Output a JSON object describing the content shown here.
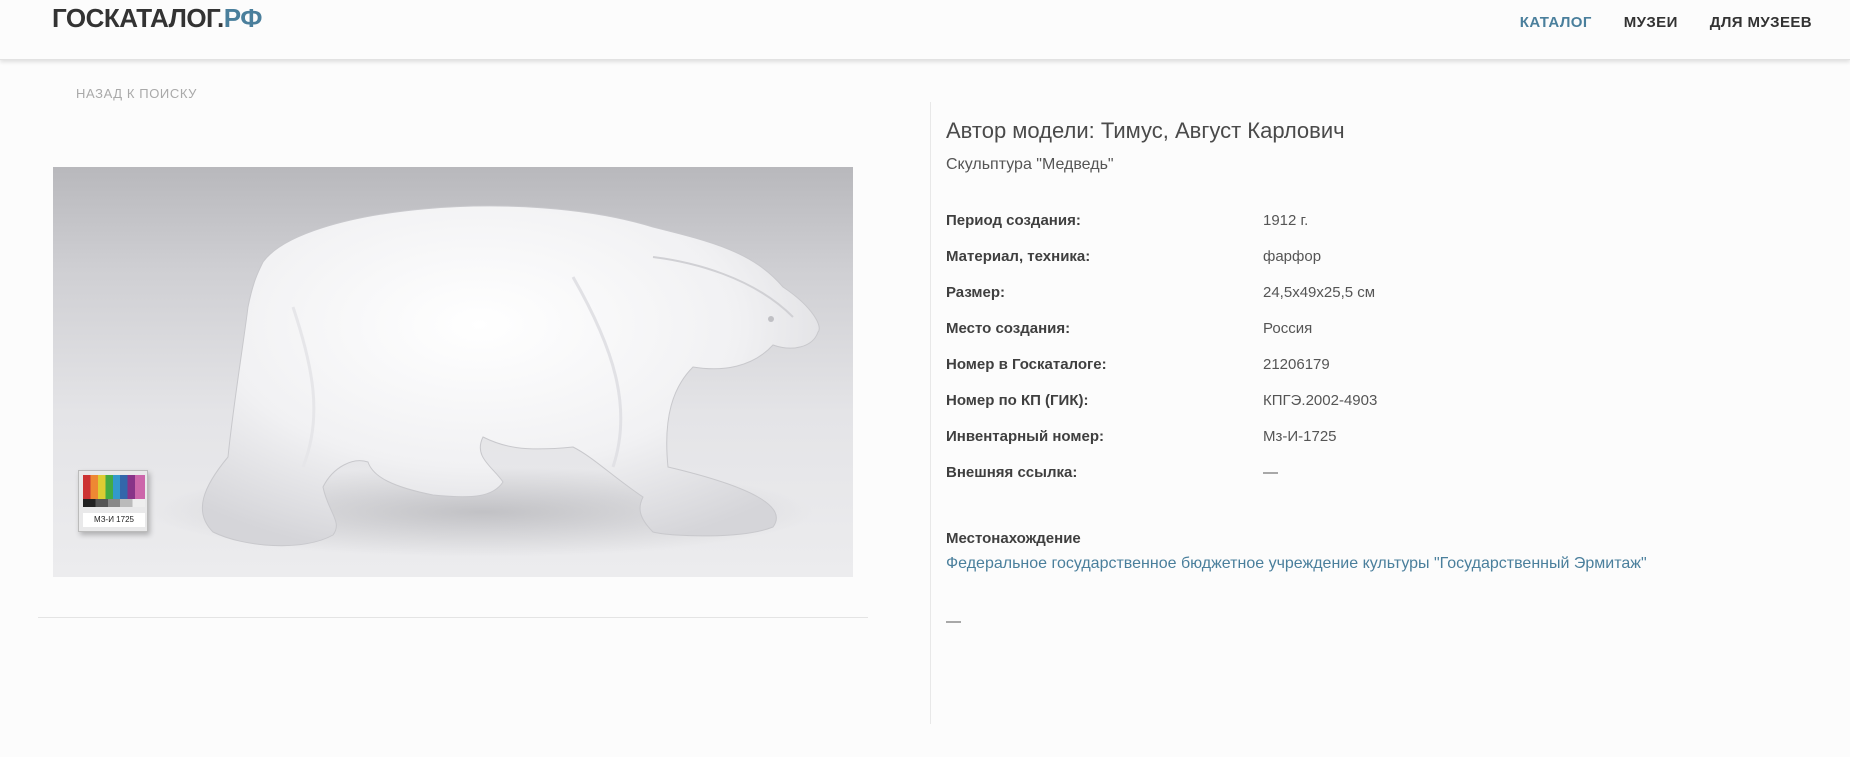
{
  "header": {
    "logo_main": "ГОСКАТАЛОГ.",
    "logo_accent": "РФ",
    "nav": [
      {
        "label": "КАТАЛОГ",
        "active": true
      },
      {
        "label": "МУЗЕИ",
        "active": false
      },
      {
        "label": "ДЛЯ МУЗЕЕВ",
        "active": false
      }
    ]
  },
  "back_link": "НАЗАД К ПОИСКУ",
  "photo": {
    "tag_text": "МЗ-И 1725"
  },
  "item": {
    "author": "Автор модели: Тимус, Август Карлович",
    "title": "Скульптура \"Медведь\"",
    "properties": [
      {
        "label": "Период создания:",
        "value": "1912 г."
      },
      {
        "label": "Материал, техника:",
        "value": "фарфор"
      },
      {
        "label": "Размер:",
        "value": "24,5х49х25,5 см"
      },
      {
        "label": "Место создания:",
        "value": "Россия"
      },
      {
        "label": "Номер в Госкаталоге:",
        "value": "21206179"
      },
      {
        "label": "Номер по КП (ГИК):",
        "value": "КПГЭ.2002-4903"
      },
      {
        "label": "Инвентарный номер:",
        "value": "Мз-И-1725"
      },
      {
        "label": "Внешняя ссылка:",
        "value": "—"
      }
    ],
    "location_title": "Местонахождение",
    "location_link": "Федеральное государственное бюджетное учреждение культуры \"Государственный Эрмитаж\"",
    "description": "—"
  },
  "colors": {
    "accent": "#4a7f9c",
    "text": "#444444",
    "background": "#fcfcfc"
  }
}
